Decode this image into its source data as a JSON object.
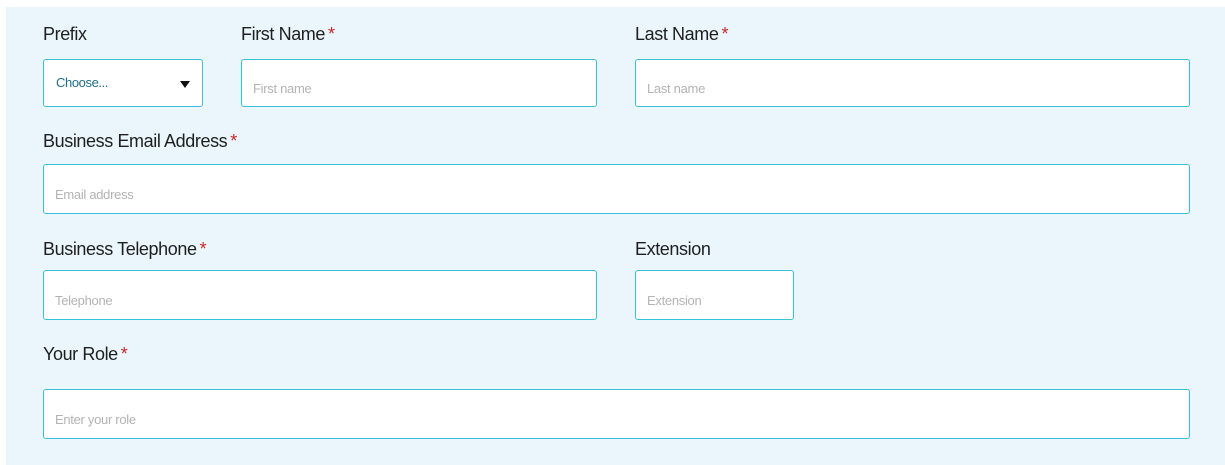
{
  "form": {
    "prefix": {
      "label": "Prefix",
      "selected": "Choose..."
    },
    "first_name": {
      "label": "First Name",
      "required_mark": "*",
      "placeholder": "First name"
    },
    "last_name": {
      "label": "Last Name",
      "required_mark": "*",
      "placeholder": "Last name"
    },
    "email": {
      "label": "Business Email Address",
      "required_mark": "*",
      "placeholder": "Email address"
    },
    "telephone": {
      "label": "Business Telephone",
      "required_mark": "*",
      "placeholder": "Telephone"
    },
    "extension": {
      "label": "Extension",
      "placeholder": "Extension"
    },
    "role": {
      "label": "Your Role",
      "required_mark": "*",
      "placeholder": "Enter your role"
    }
  },
  "icons": {
    "dropdown": "caret-down-icon"
  },
  "colors": {
    "panel_background": "#eaf6fb",
    "input_border": "#39c0d8",
    "required_star": "#c62828",
    "select_text": "#1f6f86",
    "placeholder": "#b3b3b3"
  }
}
